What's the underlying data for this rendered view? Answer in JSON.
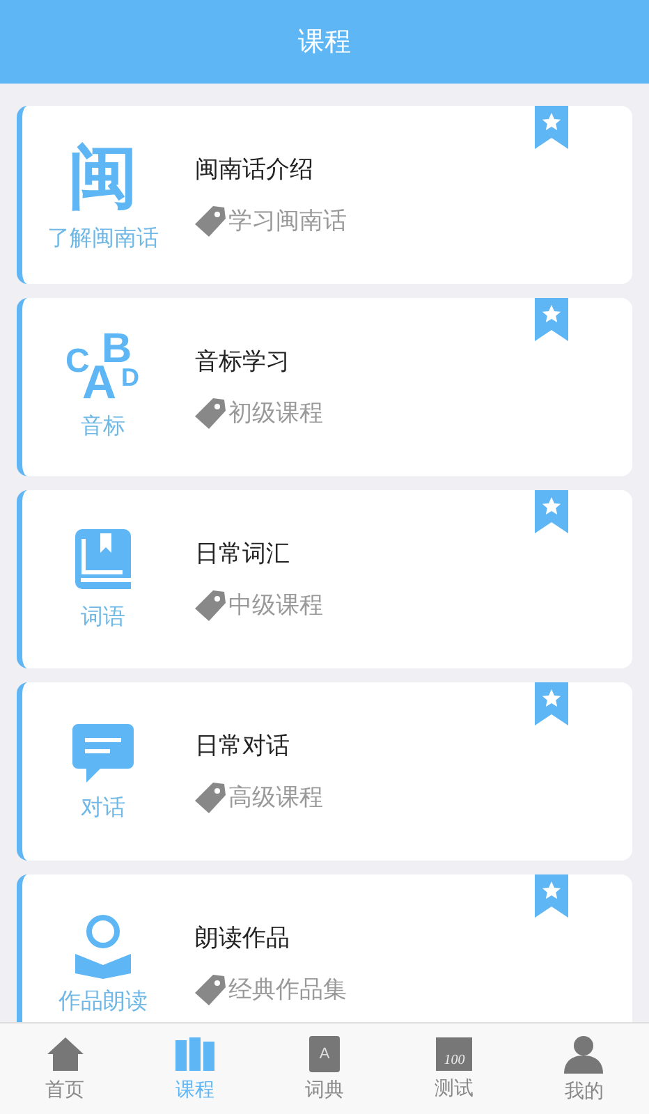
{
  "header": {
    "title": "课程"
  },
  "courses": [
    {
      "icon": {
        "kind": "glyph",
        "text": "闽"
      },
      "icon_label": "了解闽南话",
      "title": "闽南话介绍",
      "tag": "学习闽南话",
      "bookmarked": true
    },
    {
      "icon": {
        "kind": "letters",
        "letters": [
          "C",
          "A",
          "B",
          "D"
        ]
      },
      "icon_label": "音标",
      "title": "音标学习",
      "tag": "初级课程",
      "bookmarked": true
    },
    {
      "icon": {
        "kind": "book"
      },
      "icon_label": "词语",
      "title": "日常词汇",
      "tag": "中级课程",
      "bookmarked": true
    },
    {
      "icon": {
        "kind": "chat"
      },
      "icon_label": "对话",
      "title": "日常对话",
      "tag": "高级课程",
      "bookmarked": true
    },
    {
      "icon": {
        "kind": "reader"
      },
      "icon_label": "作品朗读",
      "title": "朗读作品",
      "tag": "经典作品集",
      "bookmarked": true
    }
  ],
  "tabs": [
    {
      "icon": {
        "kind": "home"
      },
      "label": "首页",
      "selected": false
    },
    {
      "icon": {
        "kind": "books"
      },
      "label": "课程",
      "selected": true
    },
    {
      "icon": {
        "kind": "dictionary",
        "text": "A"
      },
      "label": "词典",
      "selected": false
    },
    {
      "icon": {
        "kind": "test",
        "text": "100"
      },
      "label": "测试",
      "selected": false
    },
    {
      "icon": {
        "kind": "person"
      },
      "label": "我的",
      "selected": false
    }
  ]
}
